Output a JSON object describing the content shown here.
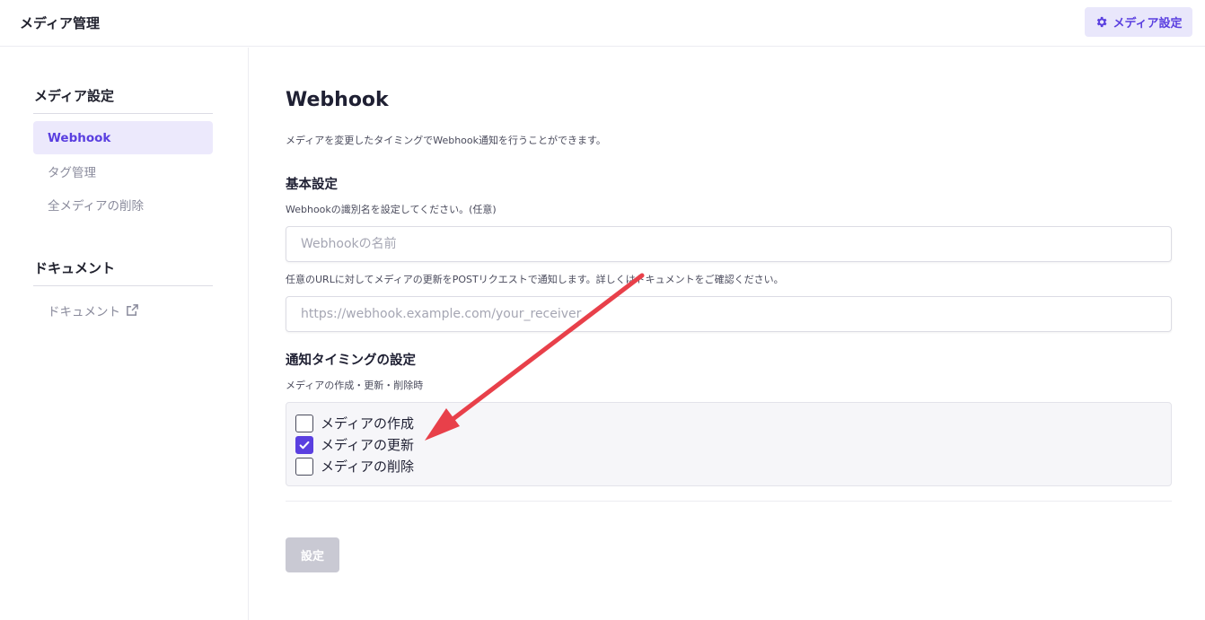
{
  "header": {
    "title": "メディア管理",
    "settings_button": "メディア設定"
  },
  "sidebar": {
    "section1_title": "メディア設定",
    "items": [
      {
        "label": "Webhook",
        "active": true
      },
      {
        "label": "タグ管理",
        "active": false
      },
      {
        "label": "全メディアの削除",
        "active": false
      }
    ],
    "section2_title": "ドキュメント",
    "doc_link": "ドキュメント"
  },
  "main": {
    "title": "Webhook",
    "description": "メディアを変更したタイミングでWebhook通知を行うことができます。",
    "basic_section_title": "基本設定",
    "name_help": "Webhookの識別名を設定してください。(任意)",
    "name_placeholder": "Webhookの名前",
    "url_help": "任意のURLに対してメディアの更新をPOSTリクエストで通知します。詳しくはドキュメントをご確認ください。",
    "url_placeholder": "https://webhook.example.com/your_receiver",
    "timing_section_title": "通知タイミングの設定",
    "timing_help": "メディアの作成・更新・削除時",
    "checkboxes": [
      {
        "label": "メディアの作成",
        "checked": false
      },
      {
        "label": "メディアの更新",
        "checked": true
      },
      {
        "label": "メディアの削除",
        "checked": false
      }
    ],
    "submit_label": "設定"
  },
  "colors": {
    "accent": "#5a3fe0",
    "annotation_arrow": "#e8404a"
  }
}
